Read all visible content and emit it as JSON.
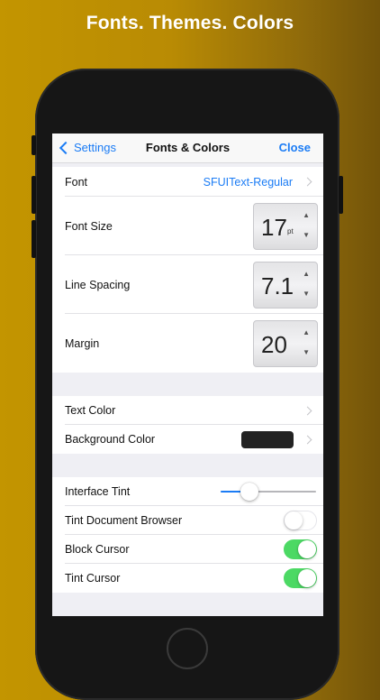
{
  "headline": "Fonts. Themes. Colors",
  "colors": {
    "accent": "#1b7cf5",
    "toggle_on": "#4cd964",
    "background_swatch": "#232323"
  },
  "navbar": {
    "back_label": "Settings",
    "title": "Fonts & Colors",
    "close_label": "Close"
  },
  "font_row": {
    "label": "Font",
    "value": "SFUIText-Regular"
  },
  "font_size": {
    "label": "Font Size",
    "value": "17",
    "unit": "pt"
  },
  "line_spacing": {
    "label": "Line Spacing",
    "value": "7.1"
  },
  "margin": {
    "label": "Margin",
    "value": "20"
  },
  "text_color": {
    "label": "Text Color"
  },
  "background_color": {
    "label": "Background Color"
  },
  "interface_tint": {
    "label": "Interface Tint",
    "level": 0.25
  },
  "tint_document_browser": {
    "label": "Tint Document Browser",
    "on": false
  },
  "block_cursor": {
    "label": "Block Cursor",
    "on": true
  },
  "tint_cursor": {
    "label": "Tint Cursor",
    "on": true
  },
  "stepper_icons": {
    "up": "▲",
    "down": "▼"
  }
}
